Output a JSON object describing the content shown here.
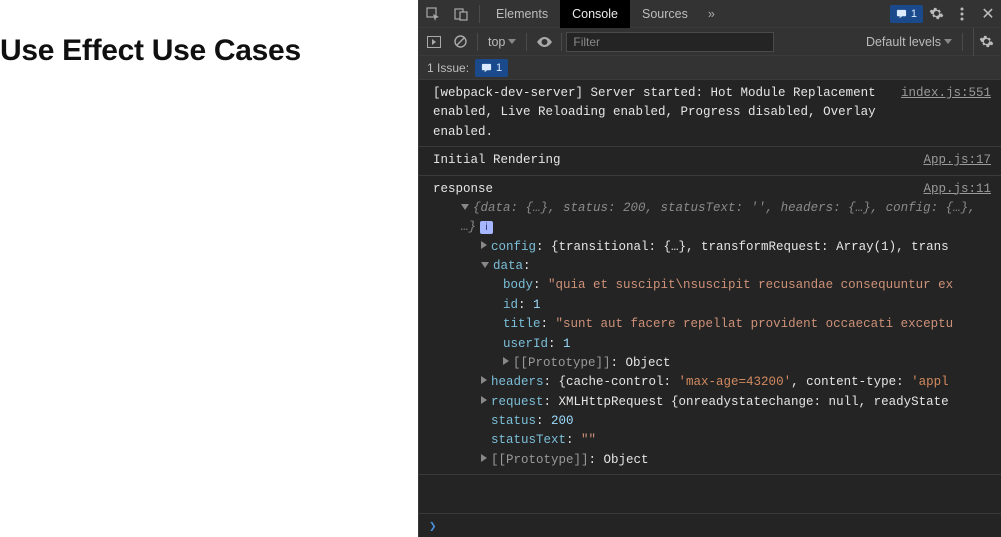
{
  "app": {
    "title": "Use Effect Use Cases"
  },
  "devtools": {
    "tabs": {
      "elements": "Elements",
      "console": "Console",
      "sources": "Sources"
    },
    "issues_count": "1",
    "toolbar": {
      "context": "top",
      "filter_placeholder": "Filter",
      "levels": "Default levels"
    },
    "issues_bar": {
      "label": "1 Issue:",
      "count": "1"
    },
    "logs": {
      "webpack": {
        "text": "[webpack-dev-server] Server started: Hot Module Replacement enabled, Live Reloading enabled, Progress disabled, Overlay enabled.",
        "src": "index.js:551"
      },
      "initial": {
        "text": "Initial Rendering",
        "src": "App.js:17"
      },
      "response": {
        "label": "response",
        "src": "App.js:11",
        "summary_pre": "{data: {…}, status: ",
        "summary_status": "200",
        "summary_mid": ", statusText: ",
        "summary_st_val": "''",
        "summary_post": ", headers: {…}, config: {…}, …}",
        "info": "i",
        "config_key": "config",
        "config_val": ": {transitional: {…}, transformRequest: Array(1), trans",
        "data_key": "data",
        "data_colon": ":",
        "body_key": "body",
        "body_val": "\"quia et suscipit\\nsuscipit recusandae consequuntur ex",
        "id_key": "id",
        "id_val": "1",
        "title_key": "title",
        "title_val": "\"sunt aut facere repellat provident occaecati exceptu",
        "userId_key": "userId",
        "userId_val": "1",
        "proto_key": "[[Prototype]]",
        "proto_val": ": Object",
        "headers_key": "headers",
        "headers_pre": ": {cache-control: ",
        "headers_cc": "'max-age=43200'",
        "headers_post": ", content-type: ",
        "headers_ct": "'appl",
        "request_key": "request",
        "request_val": ": XMLHttpRequest {onreadystatechange: null, readyState",
        "status_key": "status",
        "status_val": "200",
        "statusText_key": "statusText",
        "statusText_val": "\"\"",
        "proto2_key": "[[Prototype]]",
        "proto2_val": ": Object"
      }
    },
    "prompt": "❯"
  }
}
